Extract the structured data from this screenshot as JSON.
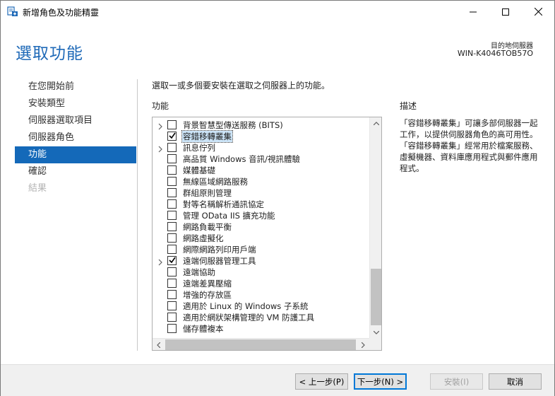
{
  "window": {
    "title": "新增角色及功能精靈"
  },
  "header": {
    "page_title": "選取功能",
    "dest_label": "目的地伺服器",
    "dest_server": "WIN-K4046TOB57O"
  },
  "nav": {
    "items": [
      {
        "label": "在您開始前",
        "state": "normal"
      },
      {
        "label": "安裝類型",
        "state": "normal"
      },
      {
        "label": "伺服器選取項目",
        "state": "normal"
      },
      {
        "label": "伺服器角色",
        "state": "normal"
      },
      {
        "label": "功能",
        "state": "active"
      },
      {
        "label": "確認",
        "state": "normal"
      },
      {
        "label": "結果",
        "state": "disabled"
      }
    ]
  },
  "main": {
    "instruction": "選取一或多個要安裝在選取之伺服器上的功能。",
    "features_label": "功能",
    "description_label": "描述",
    "description_text": "「容錯移轉叢集」可讓多部伺服器一起工作，以提供伺服器角色的高可用性。「容錯移轉叢集」經常用於檔案服務、虛擬機器、資料庫應用程式與郵件應用程式。",
    "features": [
      {
        "label": "背景智慧型傳送服務 (BITS)",
        "checked": false,
        "expandable": true,
        "selected": false
      },
      {
        "label": "容錯移轉叢集",
        "checked": true,
        "expandable": false,
        "selected": true
      },
      {
        "label": "訊息佇列",
        "checked": false,
        "expandable": true,
        "selected": false
      },
      {
        "label": "高品質 Windows 音訊/視訊體驗",
        "checked": false,
        "expandable": false,
        "selected": false
      },
      {
        "label": "媒體基礎",
        "checked": false,
        "expandable": false,
        "selected": false
      },
      {
        "label": "無線區域網路服務",
        "checked": false,
        "expandable": false,
        "selected": false
      },
      {
        "label": "群組原則管理",
        "checked": false,
        "expandable": false,
        "selected": false
      },
      {
        "label": "對等名稱解析通訊協定",
        "checked": false,
        "expandable": false,
        "selected": false
      },
      {
        "label": "管理 OData IIS 擴充功能",
        "checked": false,
        "expandable": false,
        "selected": false
      },
      {
        "label": "網路負載平衡",
        "checked": false,
        "expandable": false,
        "selected": false
      },
      {
        "label": "網路虛擬化",
        "checked": false,
        "expandable": false,
        "selected": false
      },
      {
        "label": "網際網路列印用戶端",
        "checked": false,
        "expandable": false,
        "selected": false
      },
      {
        "label": "遠端伺服器管理工具",
        "checked": true,
        "expandable": true,
        "selected": false
      },
      {
        "label": "遠端協助",
        "checked": false,
        "expandable": false,
        "selected": false
      },
      {
        "label": "遠端差異壓縮",
        "checked": false,
        "expandable": false,
        "selected": false
      },
      {
        "label": "增強的存放區",
        "checked": false,
        "expandable": false,
        "selected": false
      },
      {
        "label": "適用於 Linux 的 Windows 子系統",
        "checked": false,
        "expandable": false,
        "selected": false
      },
      {
        "label": "適用於網狀架構管理的 VM 防護工具",
        "checked": false,
        "expandable": false,
        "selected": false
      },
      {
        "label": "儲存體複本",
        "checked": false,
        "expandable": false,
        "selected": false
      }
    ]
  },
  "footer": {
    "back_label": "< 上一步(P)",
    "next_label": "下一步(N) >",
    "install_label": "安裝(I)",
    "cancel_label": "取消"
  },
  "colors": {
    "accent": "#1469b9",
    "title_blue": "#1f6ab8",
    "selection": "#cce4f7"
  }
}
